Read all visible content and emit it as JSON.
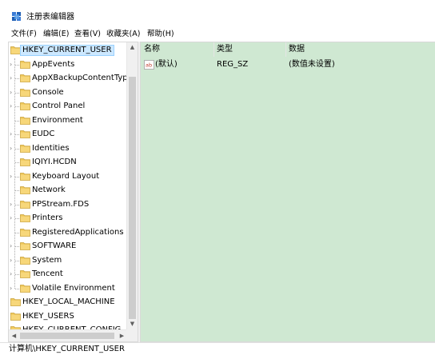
{
  "window": {
    "title": "注册表编辑器",
    "icon": "regedit-icon"
  },
  "menu": [
    {
      "label": "文件(F)"
    },
    {
      "label": "编辑(E)"
    },
    {
      "label": "查看(V)"
    },
    {
      "label": "收藏夹(A)"
    },
    {
      "label": "帮助(H)"
    }
  ],
  "tree": {
    "nodes": [
      {
        "label": "HKEY_CURRENT_USER",
        "level": 0,
        "expanded": true,
        "selected": true
      },
      {
        "label": "AppEvents",
        "level": 1,
        "has_children": true
      },
      {
        "label": "AppXBackupContentType",
        "level": 1,
        "has_children": true
      },
      {
        "label": "Console",
        "level": 1,
        "has_children": true
      },
      {
        "label": "Control Panel",
        "level": 1,
        "has_children": true
      },
      {
        "label": "Environment",
        "level": 1,
        "has_children": false
      },
      {
        "label": "EUDC",
        "level": 1,
        "has_children": true
      },
      {
        "label": "Identities",
        "level": 1,
        "has_children": true
      },
      {
        "label": "IQIYI.HCDN",
        "level": 1,
        "has_children": false
      },
      {
        "label": "Keyboard Layout",
        "level": 1,
        "has_children": true
      },
      {
        "label": "Network",
        "level": 1,
        "has_children": false
      },
      {
        "label": "PPStream.FDS",
        "level": 1,
        "has_children": true
      },
      {
        "label": "Printers",
        "level": 1,
        "has_children": true
      },
      {
        "label": "RegisteredApplications",
        "level": 1,
        "has_children": false
      },
      {
        "label": "SOFTWARE",
        "level": 1,
        "has_children": true
      },
      {
        "label": "System",
        "level": 1,
        "has_children": true
      },
      {
        "label": "Tencent",
        "level": 1,
        "has_children": true
      },
      {
        "label": "Volatile Environment",
        "level": 1,
        "has_children": true
      },
      {
        "label": "HKEY_LOCAL_MACHINE",
        "level": 0
      },
      {
        "label": "HKEY_USERS",
        "level": 0
      },
      {
        "label": "HKEY_CURRENT_CONFIG",
        "level": 0
      }
    ]
  },
  "values_pane": {
    "columns": [
      {
        "label": "名称"
      },
      {
        "label": "类型"
      },
      {
        "label": "数据"
      }
    ],
    "rows": [
      {
        "name": "(默认)",
        "type": "REG_SZ",
        "data": "(数值未设置)",
        "icon": "string-value-icon"
      }
    ],
    "background": "#cfe8d2"
  },
  "status": {
    "path": "计算机\\HKEY_CURRENT_USER"
  },
  "colors": {
    "folder": "#f0c85a",
    "selection": "#cce8ff"
  }
}
